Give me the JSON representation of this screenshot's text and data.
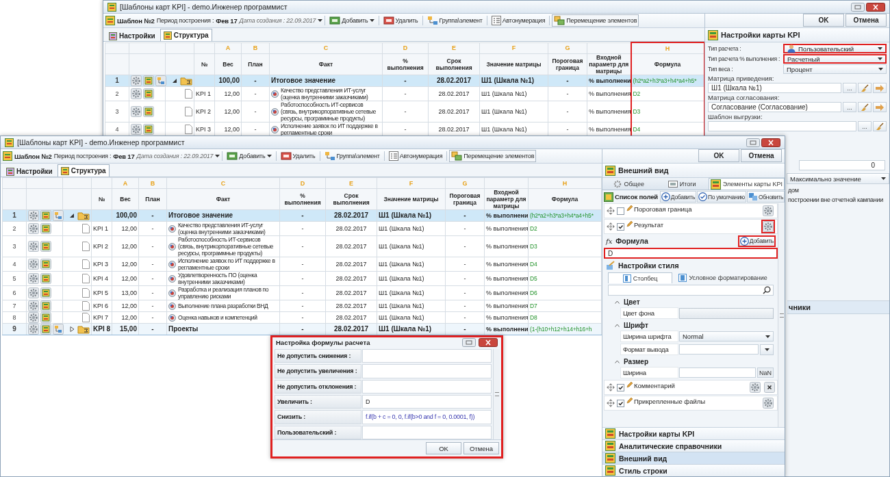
{
  "back_window": {
    "title": "[Шаблоны карт KPI] - demo.Инженер программист",
    "toolbar": {
      "template": "Шаблон №2",
      "period_label": "Период построения :",
      "period": "Фев 17",
      "created": "Дата создания : 22.09.2017",
      "actions": [
        {
          "label": "Добавить",
          "kind": "dropdown"
        },
        {
          "label": "Удалить",
          "kind": "plain"
        },
        {
          "label": "Группа\\элемент",
          "kind": "plain"
        },
        {
          "label": "Автонумерация",
          "kind": "plain"
        },
        {
          "label": "Перемещение элементов",
          "kind": "framed"
        }
      ]
    },
    "buttons": [
      "OK",
      "Отмена"
    ],
    "tabs": [
      {
        "label": "Настройки",
        "selected": false
      },
      {
        "label": "Структура",
        "selected": true
      }
    ],
    "table": {
      "columns": [
        {
          "name": "№"
        },
        {
          "letter": "A",
          "name": "Вес"
        },
        {
          "letter": "B",
          "name": "План"
        },
        {
          "letter": "C",
          "name": "Факт"
        },
        {
          "letter": "D",
          "name": "% выполнения"
        },
        {
          "letter": "E",
          "name": "Срок выполнения"
        },
        {
          "letter": "F",
          "name": "Значение матрицы"
        },
        {
          "letter": "G",
          "name": "Пороговая граница"
        },
        {
          "name": "Входной параметр для матрицы"
        },
        {
          "letter": "H",
          "name": "Формула",
          "highlighted": true
        }
      ],
      "rows": [
        {
          "index": "1",
          "kind": "group",
          "expanded": true,
          "selected": true,
          "weight": "100,00",
          "plan": "-",
          "fact": "Итоговое значение",
          "percent": "-",
          "due": "28.02.2017",
          "matrix": "Ш1 (Шкала №1)",
          "threshold": "-",
          "input": "% выполнени",
          "formula": "(h2*a2+h3*a3+h4*a4+h5*"
        },
        {
          "index": "2",
          "kind": "item",
          "selected": false,
          "code": "KPI 1",
          "weight": "12,00",
          "plan": "-",
          "fact": "Качество представления ИТ-услуг (оценка внутренними заказчиками)",
          "percent": "-",
          "due": "28.02.2017",
          "matrix": "Ш1 (Шкала №1)",
          "threshold": "-",
          "input": "% выполнения",
          "formula": "D2"
        },
        {
          "index": "3",
          "kind": "item",
          "selected": false,
          "code": "KPI 2",
          "weight": "12,00",
          "plan": "-",
          "fact": "Работоспособность ИТ-сервисов (связь, внутрикорпоративные сетевые ресурсы, программные продукты)",
          "percent": "-",
          "due": "28.02.2017",
          "matrix": "Ш1 (Шкала №1)",
          "threshold": "-",
          "input": "% выполнения",
          "formula": "D3"
        },
        {
          "index": "4",
          "kind": "item",
          "selected": false,
          "code": "KPI 3",
          "weight": "12,00",
          "plan": "-",
          "fact": "Исполнение заявок по ИТ поддержке в регламентные сроки",
          "percent": "-",
          "due": "28.02.2017",
          "matrix": "Ш1 (Шкала №1)",
          "threshold": "-",
          "input": "% выполнения",
          "formula": "D4"
        }
      ]
    },
    "settings_panel": {
      "title": "Настройки карты KPI",
      "fields": [
        {
          "kind": "user-dropdown",
          "label": "Тип расчета :",
          "value": "Пользовательский",
          "highlighted": true
        },
        {
          "kind": "dropdown",
          "label": "Тип расчета % выполнения :",
          "value": "Расчетный",
          "highlighted": true
        },
        {
          "kind": "dropdown",
          "label": "Тип веса :",
          "value": "Процент",
          "highlighted": false
        },
        {
          "kind": "lookup",
          "label": "Матрица приведения:",
          "value": "Ш1 (Шкала №1)",
          "button": "...",
          "has_arrow": true
        },
        {
          "kind": "lookup",
          "label": "Матрица согласования:",
          "value": "Согласование (Согласование)",
          "button": "...",
          "has_arrow": true
        },
        {
          "kind": "lookup",
          "label": "Шаблон выгрузки:",
          "button": "...",
          "has_arrow": false
        }
      ],
      "obscured": {
        "spinner_value": "0",
        "dropdown_value": "Максимально значение",
        "notes": [
          "дом",
          "построении вне отчетной кампании"
        ],
        "accordion_label": "чники"
      }
    }
  },
  "front_window": {
    "title": "[Шаблоны карт KPI] - demo.Инженер программист",
    "toolbar": {
      "template": "Шаблон №2",
      "period_label": "Период построения :",
      "period": "Фев 17",
      "created": "Дата создания : 22.09.2017",
      "actions": [
        {
          "label": "Добавить",
          "kind": "dropdown"
        },
        {
          "label": "Удалить",
          "kind": "plain"
        },
        {
          "label": "Группа\\элемент",
          "kind": "plain"
        },
        {
          "label": "Автонумерация",
          "kind": "plain"
        },
        {
          "label": "Перемещение элементов",
          "kind": "framed"
        }
      ]
    },
    "buttons": [
      "OK",
      "Отмена"
    ],
    "tabs": [
      {
        "label": "Настройки",
        "selected": false
      },
      {
        "label": "Структура",
        "selected": true
      }
    ],
    "table": {
      "columns": [
        {
          "name": "№"
        },
        {
          "letter": "A",
          "name": "Вес"
        },
        {
          "letter": "B",
          "name": "План"
        },
        {
          "letter": "C",
          "name": "Факт"
        },
        {
          "letter": "D",
          "name": "% выполнения"
        },
        {
          "letter": "E",
          "name": "Срок выполнения"
        },
        {
          "letter": "F",
          "name": "Значение матрицы"
        },
        {
          "letter": "G",
          "name": "Пороговая граница"
        },
        {
          "name": "Входной параметр для матрицы"
        },
        {
          "letter": "H",
          "name": "Формула",
          "highlighted": false
        }
      ],
      "rows": [
        {
          "index": "1",
          "kind": "group",
          "expanded": true,
          "selected": true,
          "weight": "100,00",
          "plan": "-",
          "fact": "Итоговое значение",
          "percent": "-",
          "due": "28.02.2017",
          "matrix": "Ш1 (Шкала №1)",
          "threshold": "-",
          "input": "% выполнени",
          "formula": "(h2*a2+h3*a3+h4*a4+h5*"
        },
        {
          "index": "2",
          "kind": "item",
          "selected": false,
          "code": "KPI 1",
          "weight": "12,00",
          "plan": "-",
          "fact": "Качество представления ИТ-услуг (оценка внутренними заказчиками)",
          "percent": "-",
          "due": "28.02.2017",
          "matrix": "Ш1 (Шкала №1)",
          "threshold": "-",
          "input": "% выполнения",
          "formula": "D2"
        },
        {
          "index": "3",
          "kind": "item",
          "selected": false,
          "code": "KPI 2",
          "weight": "12,00",
          "plan": "-",
          "fact": "Работоспособность ИТ-сервисов (связь, внутрикорпоративные сетевые ресурсы, программные продукты)",
          "percent": "-",
          "due": "28.02.2017",
          "matrix": "Ш1 (Шкала №1)",
          "threshold": "-",
          "input": "% выполнения",
          "formula": "D3"
        },
        {
          "index": "4",
          "kind": "item",
          "selected": false,
          "code": "KPI 3",
          "weight": "12,00",
          "plan": "-",
          "fact": "Исполнение заявок по ИТ поддержке в регламентные сроки",
          "percent": "-",
          "due": "28.02.2017",
          "matrix": "Ш1 (Шкала №1)",
          "threshold": "-",
          "input": "% выполнения",
          "formula": "D4"
        },
        {
          "index": "5",
          "kind": "item",
          "selected": false,
          "code": "KPI 4",
          "weight": "12,00",
          "plan": "-",
          "fact": "Удовлетворенность ПО (оценка внутренними заказчиками)",
          "percent": "-",
          "due": "28.02.2017",
          "matrix": "Ш1 (Шкала №1)",
          "threshold": "-",
          "input": "% выполнения",
          "formula": "D5"
        },
        {
          "index": "6",
          "kind": "item",
          "selected": false,
          "code": "KPI 5",
          "weight": "13,00",
          "plan": "-",
          "fact": "Разработка и реализация планов по управлению рисками",
          "percent": "-",
          "due": "28.02.2017",
          "matrix": "Ш1 (Шкала №1)",
          "threshold": "-",
          "input": "% выполнения",
          "formula": "D6"
        },
        {
          "index": "7",
          "kind": "item",
          "selected": false,
          "code": "KPI 6",
          "weight": "12,00",
          "plan": "-",
          "fact": "Выполнение плана разработки ВНД",
          "percent": "-",
          "due": "28.02.2017",
          "matrix": "Ш1 (Шкала №1)",
          "threshold": "-",
          "input": "% выполнения",
          "formula": "D7"
        },
        {
          "index": "8",
          "kind": "item",
          "selected": false,
          "code": "KPI 7",
          "weight": "12,00",
          "plan": "-",
          "fact": "Оценка навыков и компетенций",
          "percent": "-",
          "due": "28.02.2017",
          "matrix": "Ш1 (Шкала №1)",
          "threshold": "-",
          "input": "% выполнения",
          "formula": "D8"
        },
        {
          "index": "9",
          "kind": "group",
          "expanded": false,
          "selected": false,
          "code": "KPI 8",
          "weight": "15,00",
          "plan": "-",
          "fact": "Проекты",
          "percent": "-",
          "due": "28.02.2017",
          "matrix": "Ш1 (Шкала №1)",
          "threshold": "-",
          "input": "% выполнени",
          "formula": "(1-(h10+h12+h14+h16+h"
        }
      ]
    },
    "appearance_panel": {
      "title": "Внешний вид",
      "tabs": [
        {
          "label": "Общее",
          "selected": false
        },
        {
          "label": "Итоги",
          "selected": false
        },
        {
          "label": "Элементы карты KPI",
          "selected": true
        }
      ],
      "list_title": "Список полей",
      "list_actions": [
        "Добавить",
        "По умолчанию",
        "Обновить"
      ],
      "fields": [
        {
          "label": "Пороговая граница",
          "checked": false,
          "gear_highlighted": false,
          "removable": false
        },
        {
          "label": "Результат",
          "checked": true,
          "gear_highlighted": true,
          "removable": false
        }
      ],
      "formula": {
        "icon_text": "fx",
        "title": "Формула",
        "add_label": "Добавить",
        "add_highlighted": true,
        "value": "D",
        "highlighted": true
      },
      "style": {
        "title": "Настройки стиля",
        "tabs": [
          {
            "label": "Столбец",
            "selected": true
          },
          {
            "label": "Условное форматирование",
            "selected": false
          }
        ],
        "sections": [
          {
            "title": "Цвет",
            "rows": [
              {
                "label": "Цвет фона",
                "kind": "color"
              }
            ]
          },
          {
            "title": "Шрифт",
            "rows": [
              {
                "label": "Ширина шрифта",
                "kind": "dropdown",
                "value": "Normal"
              },
              {
                "label": "Формат вывода",
                "kind": "combo"
              }
            ]
          },
          {
            "title": "Размер",
            "rows": [
              {
                "label": "Ширина",
                "kind": "number",
                "button": "NaN"
              }
            ]
          }
        ]
      },
      "more_fields": [
        {
          "label": "Комментарий",
          "checked": true,
          "gear_highlighted": false,
          "removable": true
        },
        {
          "label": "Прикрепленные файлы",
          "checked": true,
          "gear_highlighted": false,
          "removable": false
        }
      ],
      "accordion": [
        {
          "label": "Настройки карты KPI",
          "selected": false
        },
        {
          "label": "Аналитические справочники",
          "selected": false
        },
        {
          "label": "Внешний вид",
          "selected": true
        },
        {
          "label": "Стиль строки",
          "selected": false
        }
      ]
    }
  },
  "dialog": {
    "title": "Настройка формулы расчета",
    "highlighted": true,
    "rows": [
      {
        "label": "Не допустить снижения :"
      },
      {
        "label": "Не допустить увеличения :"
      },
      {
        "label": "Не допустить отклонения :"
      },
      {
        "label": "Увеличить :",
        "value": "D"
      },
      {
        "label": "Снизить :",
        "value": "f.if(b + c = 0, 0, f.if(b>0 and f = 0, 0.0001, f))"
      },
      {
        "label": "Пользовательский :"
      }
    ],
    "buttons": [
      "OK",
      "Отмена"
    ]
  }
}
